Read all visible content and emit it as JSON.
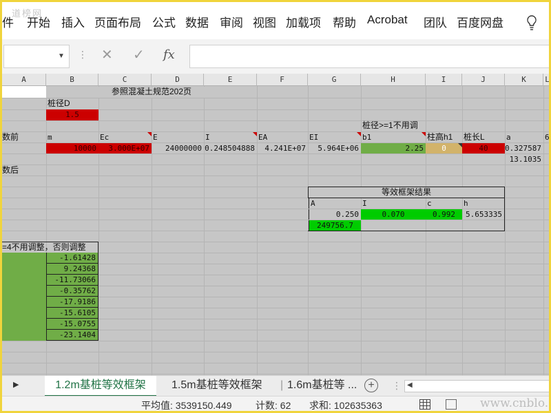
{
  "watermark_top": "道榜网",
  "ribbon": {
    "tabs": [
      "件",
      "开始",
      "插入",
      "页面布局",
      "公式",
      "数据",
      "审阅",
      "视图",
      "加载项",
      "帮助",
      "Acrobat",
      "团队",
      "百度网盘"
    ]
  },
  "formula_bar": {
    "name_box_value": "",
    "cancel_icon": "✕",
    "enter_icon": "✓",
    "fx_label": "fx",
    "formula_value": ""
  },
  "columns": [
    "A",
    "B",
    "C",
    "D",
    "E",
    "F",
    "G",
    "H",
    "I",
    "J",
    "K",
    "L"
  ],
  "sheet": {
    "title": "参照混凝土规范202页",
    "pile_d_label": "桩径D",
    "pile_d_value": "1.5",
    "note_h1": "桩径>=1不用调",
    "before_label": "数前",
    "after_label": "数后",
    "headers": {
      "m": "m",
      "Ec": "Ec",
      "E": "E",
      "I": "I",
      "EA": "EA",
      "EI": "EI",
      "b1": "b1",
      "h1": "柱高h1",
      "L": "桩长L",
      "a": "a",
      "K": "6"
    },
    "values": {
      "m": "10000",
      "Ec": "3.000E+07",
      "E": "24000000",
      "I": "0.248504888",
      "EA": "4.241E+07",
      "EI": "5.964E+06",
      "b1": "2.25",
      "h1": "0",
      "L": "40",
      "a": "0.327587",
      "a2": "13.1035"
    },
    "result_title": "等效框架结果",
    "result_headers": {
      "A": "A",
      "I": "I",
      "c": "c",
      "h": "h"
    },
    "result_values": {
      "A": "0.250",
      "I": "0.070",
      "c": "0.992",
      "h": "5.653335",
      "A2": "249756.7"
    },
    "adjust_note": "=4不用调整，否则调整",
    "list_values": [
      "-1.61428",
      "9.24368",
      "-11.73066",
      "-0.35762",
      "-17.9186",
      "-15.6105",
      "-15.0755",
      "-23.1404"
    ]
  },
  "sheet_tabs": {
    "tab1": "1.2m基桩等效框架",
    "tab2": "1.5m基桩等效框架",
    "tab3": "1.6m基桩等 ...",
    "add": "+"
  },
  "status_bar": {
    "average": "平均值: 3539150.449",
    "count": "计数: 62",
    "sum": "求和: 102635363",
    "watermark": "www.cnblo.com"
  },
  "colors": {
    "red": "#cc0000",
    "light_green": "#70ad47",
    "green": "#00cc00",
    "tan": "#d2b36a",
    "excel_green": "#217346"
  }
}
